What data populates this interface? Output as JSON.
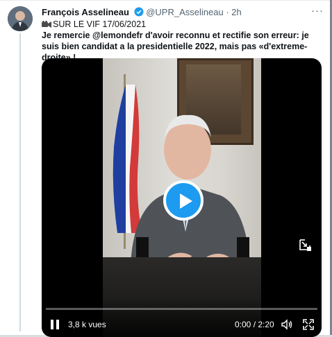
{
  "tweet": {
    "display_name": "François Asselineau",
    "handle": "@UPR_Asselineau",
    "separator": "·",
    "time": "2h",
    "more_label": "···",
    "tag_line": "SUR LE VIF 17/06/2021",
    "text": "Je remercie @lemondefr d'avoir reconnu et rectifie son erreur: je suis bien candidat a la presidentielle 2022, mais pas «d'extreme-droite» !",
    "icons": {
      "verified": "verified-badge-icon",
      "camera": "movie-camera-icon",
      "more": "more-icon"
    }
  },
  "video": {
    "views": "3,8 k vues",
    "timecode": "0:00 / 2:20",
    "progress_fraction": 0.0,
    "colors": {
      "accent": "#1d9bf0",
      "flag_blue": "#1f3fa0",
      "flag_red": "#d33a3a",
      "flag_white": "#f5f5f5"
    },
    "icons": {
      "play": "play-icon",
      "pause": "pause-icon",
      "volume": "volume-icon",
      "fullscreen": "fullscreen-icon",
      "pip": "picture-in-picture-icon"
    }
  }
}
